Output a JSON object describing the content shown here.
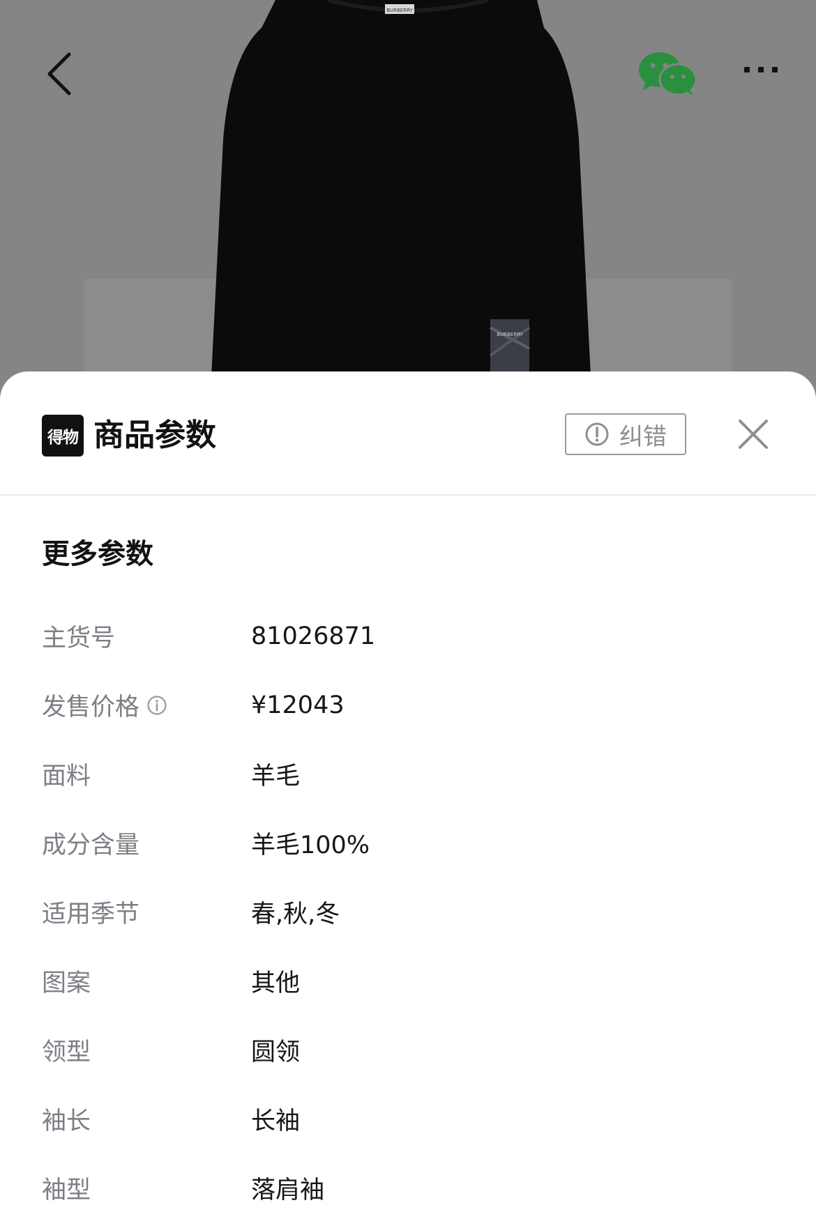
{
  "nav": {
    "back_icon": "chevron-left-icon",
    "share_icon": "wechat-icon",
    "more_icon": "more-dots-icon",
    "wechat_color": "#2a8f3e"
  },
  "product_photo": {
    "neck_label": "BURBERRY",
    "patch_label": "BURBERRY"
  },
  "sheet": {
    "logo_text": "得物",
    "title": "商品参数",
    "report_label": "纠错",
    "report_icon": "exclamation-circle-icon",
    "close_icon": "close-icon",
    "section_title": "更多参数",
    "params": [
      {
        "label": "主货号",
        "value": "81026871"
      },
      {
        "label": "发售价格",
        "value": "¥12043",
        "info_icon": "info-circle-icon"
      },
      {
        "label": "面料",
        "value": "羊毛"
      },
      {
        "label": "成分含量",
        "value": "羊毛100%"
      },
      {
        "label": "适用季节",
        "value": "春,秋,冬"
      },
      {
        "label": "图案",
        "value": "其他"
      },
      {
        "label": "领型",
        "value": "圆领"
      },
      {
        "label": "袖长",
        "value": "长袖"
      },
      {
        "label": "袖型",
        "value": "落肩袖"
      }
    ]
  }
}
